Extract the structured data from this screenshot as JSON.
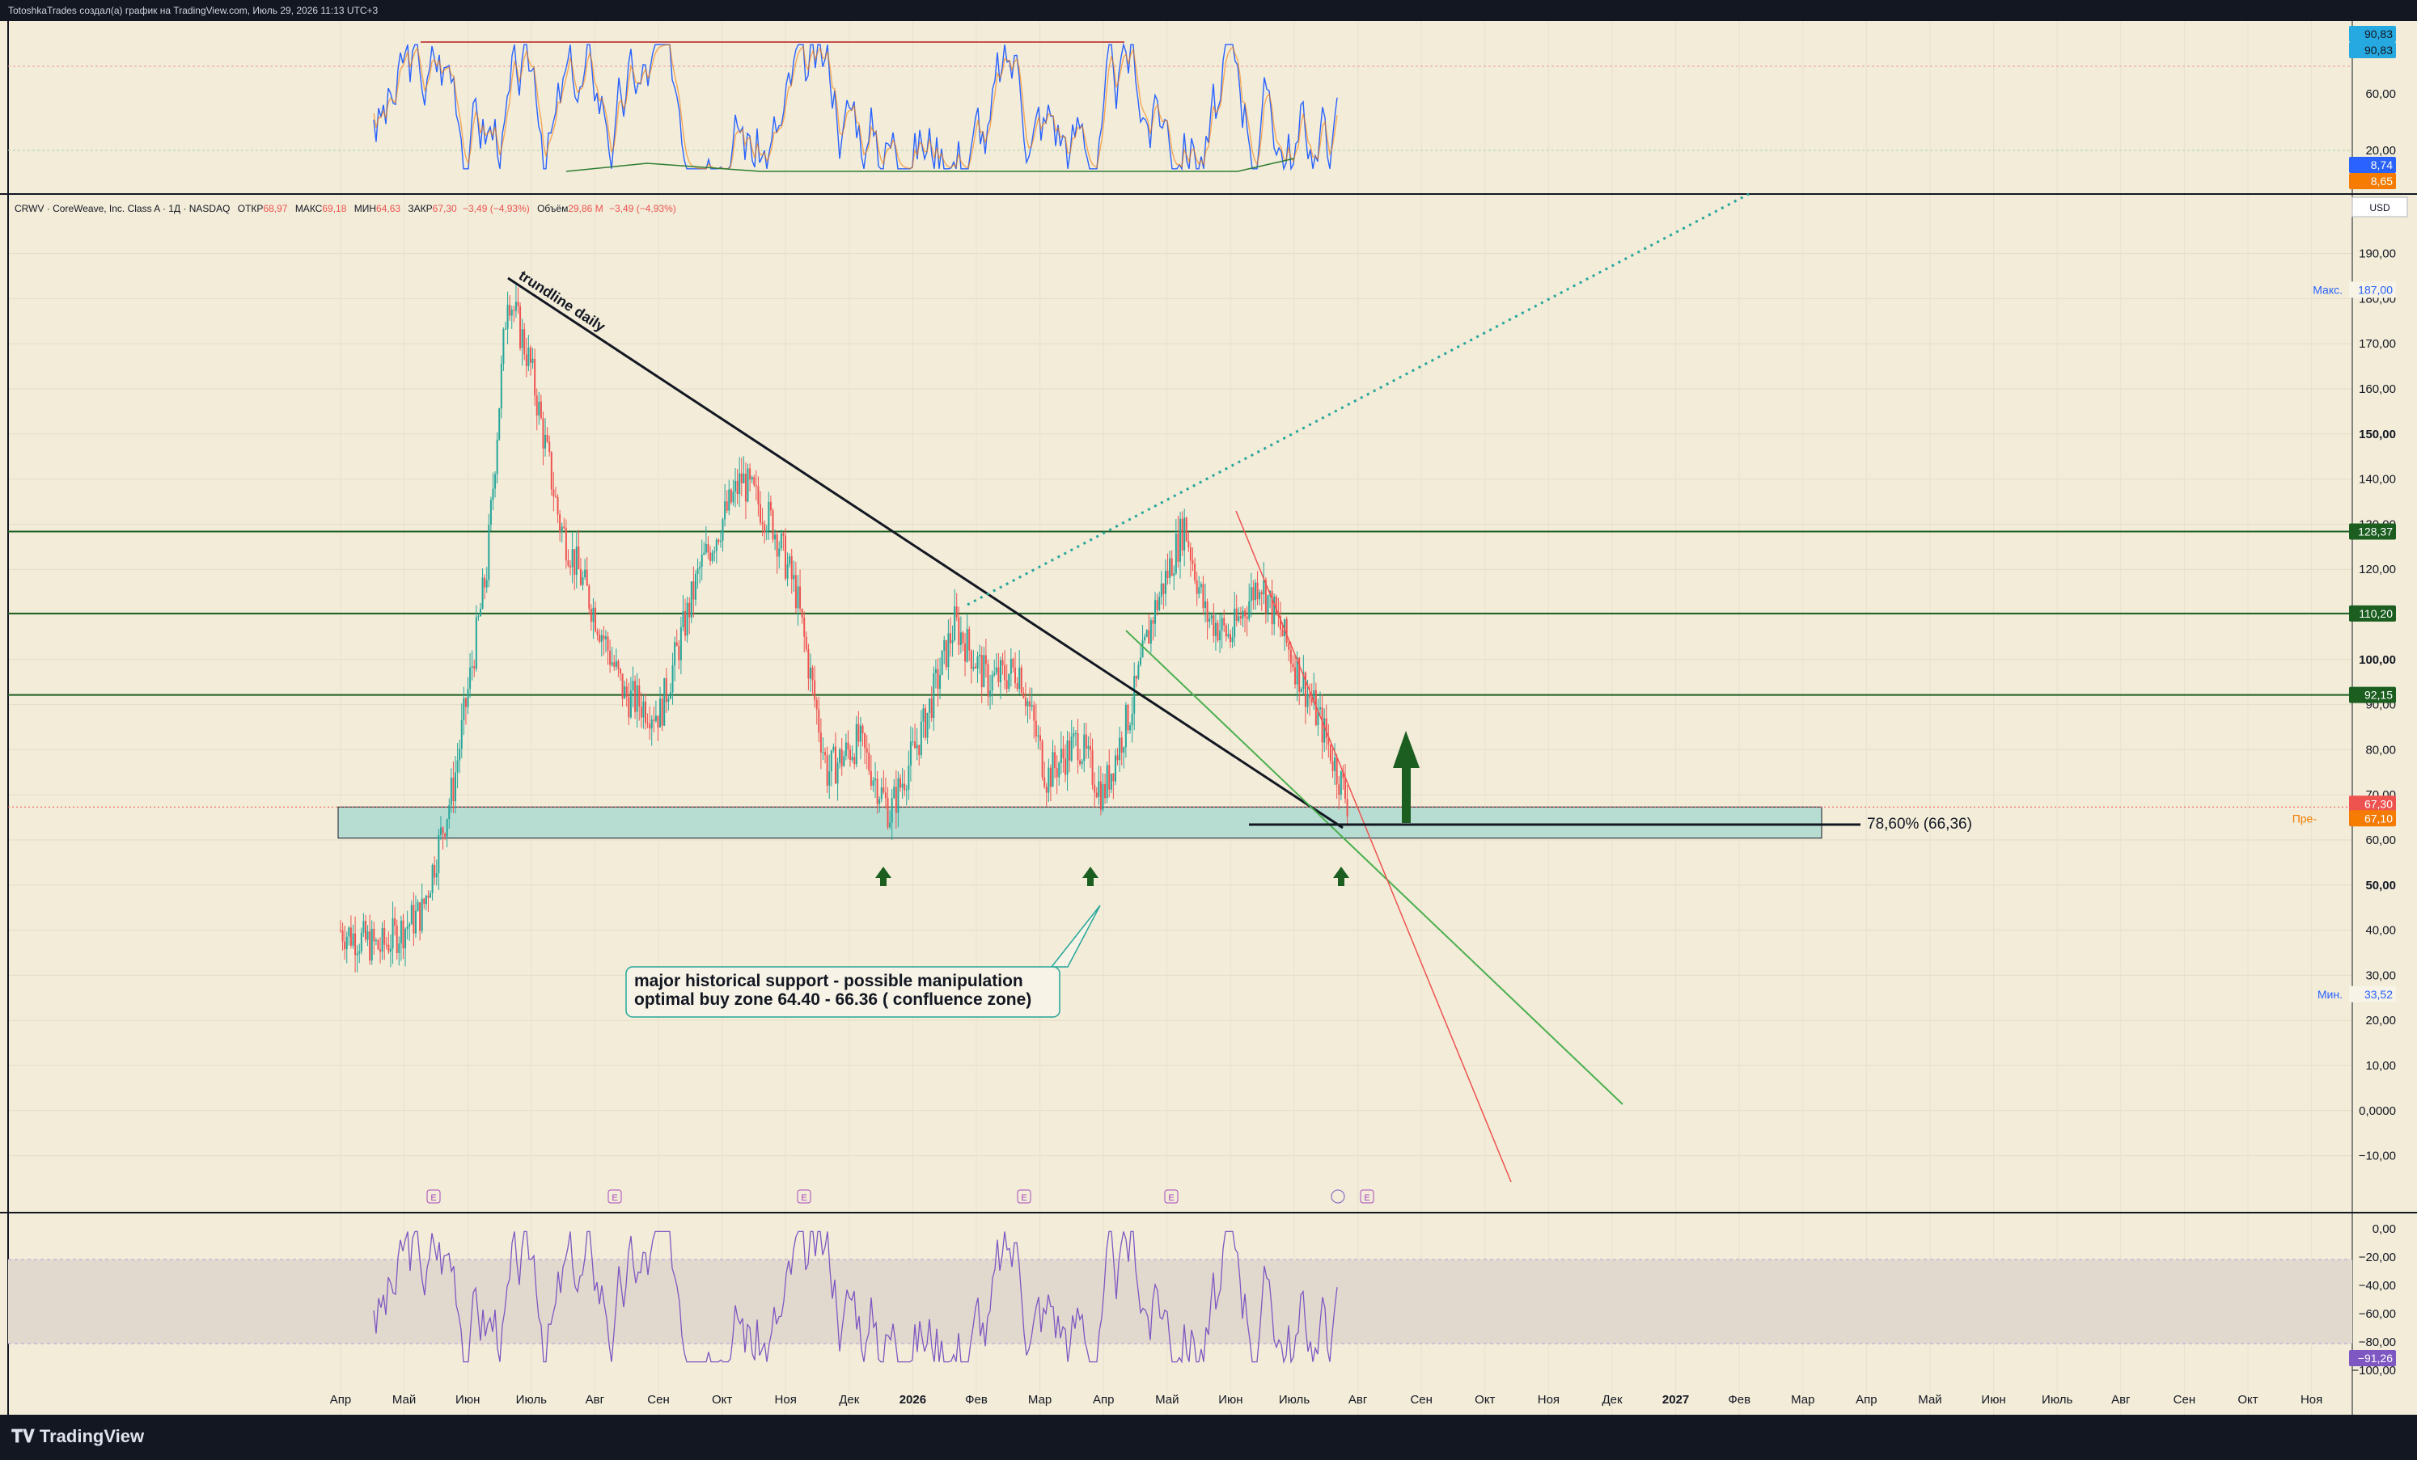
{
  "header": {
    "title": "TotoshkaTrades создал(а) график на TradingView.com, Июль 29, 2026 11:13 UTC+3"
  },
  "footer": {
    "brand": "TradingView"
  },
  "colors": {
    "background": "#f2ecd9",
    "up": "#26a69a",
    "down": "#ef5350",
    "hline": "#1b5e20",
    "zone": "#b7ddd3",
    "stoch_k": "#2962ff",
    "stoch_d": "#f57c00",
    "wpr": "#7e57c2"
  },
  "legend": {
    "symbol": "CRWV · CoreWeave, Inc. Class A · 1Д · NASDAQ",
    "open_label": "ОТКР",
    "open": "68,97",
    "high_label": "МАКС",
    "high": "69,18",
    "low_label": "МИН",
    "low": "64,63",
    "close_label": "ЗАКР",
    "close": "67,30",
    "change": "−3,49 (−4,93%)",
    "volume_label": "Объём",
    "volume": "29,86 M",
    "volume_change": "−3,49 (−4,93%)"
  },
  "currency": "USD",
  "chart_data": [
    {
      "type": "candlestick",
      "title": "CRWV · CoreWeave, Inc. Class A · 1Д · NASDAQ",
      "yticks": [
        "190,00",
        "180,00",
        "170,00",
        "160,00",
        "150,00",
        "140,00",
        "130,00",
        "120,00",
        "110,00",
        "100,00",
        "90,00",
        "80,00",
        "70,00",
        "60,00",
        "50,00",
        "40,00",
        "30,00",
        "20,00",
        "10,00",
        "0,0000",
        "−10,00"
      ],
      "xticks": [
        "Апр",
        "Май",
        "Июн",
        "Июль",
        "Авг",
        "Сен",
        "Окт",
        "Ноя",
        "Дек",
        "2026",
        "Фев",
        "Мар",
        "Апр",
        "Май",
        "Июн",
        "Июль",
        "Авг",
        "Сен",
        "Окт",
        "Ноя",
        "Дек",
        "2027",
        "Фев",
        "Мар",
        "Апр",
        "Май",
        "Июн",
        "Июль",
        "Авг",
        "Сен",
        "Окт",
        "Ноя"
      ],
      "close_series_approx": [
        {
          "x": "2025-04-01",
          "y": 40
        },
        {
          "x": "2025-04-20",
          "y": 36
        },
        {
          "x": "2025-05-10",
          "y": 44
        },
        {
          "x": "2025-05-25",
          "y": 72
        },
        {
          "x": "2025-06-10",
          "y": 120
        },
        {
          "x": "2025-06-20",
          "y": 182
        },
        {
          "x": "2025-07-01",
          "y": 165
        },
        {
          "x": "2025-07-15",
          "y": 130
        },
        {
          "x": "2025-08-01",
          "y": 110
        },
        {
          "x": "2025-08-15",
          "y": 92
        },
        {
          "x": "2025-09-01",
          "y": 88
        },
        {
          "x": "2025-09-20",
          "y": 120
        },
        {
          "x": "2025-10-10",
          "y": 140
        },
        {
          "x": "2025-10-25",
          "y": 130
        },
        {
          "x": "2025-11-05",
          "y": 115
        },
        {
          "x": "2025-11-20",
          "y": 75
        },
        {
          "x": "2025-12-05",
          "y": 82
        },
        {
          "x": "2025-12-20",
          "y": 66
        },
        {
          "x": "2026-01-05",
          "y": 85
        },
        {
          "x": "2026-01-20",
          "y": 108
        },
        {
          "x": "2026-02-05",
          "y": 95
        },
        {
          "x": "2026-02-20",
          "y": 98
        },
        {
          "x": "2026-03-05",
          "y": 74
        },
        {
          "x": "2026-03-20",
          "y": 82
        },
        {
          "x": "2026-04-01",
          "y": 70
        },
        {
          "x": "2026-04-15",
          "y": 90
        },
        {
          "x": "2026-04-25",
          "y": 110
        },
        {
          "x": "2026-05-10",
          "y": 130
        },
        {
          "x": "2026-05-20",
          "y": 110
        },
        {
          "x": "2026-06-01",
          "y": 105
        },
        {
          "x": "2026-06-15",
          "y": 118
        },
        {
          "x": "2026-07-01",
          "y": 100
        },
        {
          "x": "2026-07-15",
          "y": 85
        },
        {
          "x": "2026-07-28",
          "y": 67.3
        }
      ],
      "horizontal_levels": [
        128.37,
        110.2,
        92.15
      ],
      "support_zone": {
        "low": 60.4,
        "high": 67.3
      },
      "fib_level": {
        "label": "78,60% (66,36)",
        "value": 66.36
      },
      "trendline_label": "trundline daily",
      "annotation": {
        "line1": "major historical support - possible manipulation",
        "line2": "optimal buy zone 64.40 - 66.36 ( confluence zone)"
      },
      "price_tags": {
        "level1": "128,37",
        "level2": "110,20",
        "level3": "92,15",
        "last": "67,30",
        "prev": "67,10",
        "prev_label": "Пре-",
        "max_label": "Макс.",
        "max": "187,00",
        "min_label": "Мин.",
        "min": "33,52"
      },
      "event_marks": [
        "E",
        "E",
        "E",
        "E",
        "E",
        "E"
      ]
    },
    {
      "type": "line",
      "name": "stochastic",
      "yticks": [
        "60,00",
        "20,00"
      ],
      "tags": {
        "a": "90,83",
        "b": "90,83",
        "c": "8,74",
        "d": "8,65"
      }
    },
    {
      "type": "line",
      "name": "williams_r",
      "yticks": [
        "0,00",
        "−20,00",
        "−40,00",
        "−60,00",
        "−80,00",
        "−100,00"
      ],
      "tag": "−91,26"
    }
  ]
}
